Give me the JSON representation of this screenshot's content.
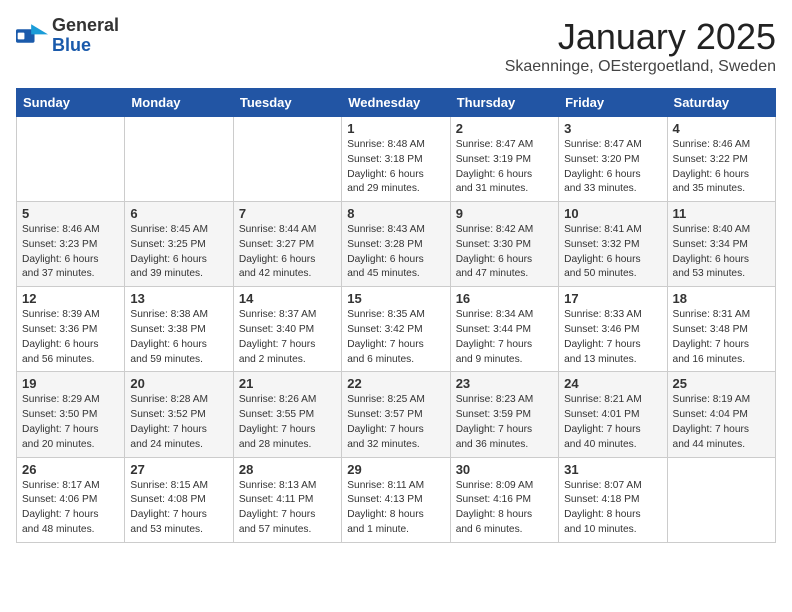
{
  "header": {
    "logo_general": "General",
    "logo_blue": "Blue",
    "title": "January 2025",
    "location": "Skaenninge, OEstergoetland, Sweden"
  },
  "weekdays": [
    "Sunday",
    "Monday",
    "Tuesday",
    "Wednesday",
    "Thursday",
    "Friday",
    "Saturday"
  ],
  "weeks": [
    [
      {
        "day": "",
        "info": ""
      },
      {
        "day": "",
        "info": ""
      },
      {
        "day": "",
        "info": ""
      },
      {
        "day": "1",
        "info": "Sunrise: 8:48 AM\nSunset: 3:18 PM\nDaylight: 6 hours\nand 29 minutes."
      },
      {
        "day": "2",
        "info": "Sunrise: 8:47 AM\nSunset: 3:19 PM\nDaylight: 6 hours\nand 31 minutes."
      },
      {
        "day": "3",
        "info": "Sunrise: 8:47 AM\nSunset: 3:20 PM\nDaylight: 6 hours\nand 33 minutes."
      },
      {
        "day": "4",
        "info": "Sunrise: 8:46 AM\nSunset: 3:22 PM\nDaylight: 6 hours\nand 35 minutes."
      }
    ],
    [
      {
        "day": "5",
        "info": "Sunrise: 8:46 AM\nSunset: 3:23 PM\nDaylight: 6 hours\nand 37 minutes."
      },
      {
        "day": "6",
        "info": "Sunrise: 8:45 AM\nSunset: 3:25 PM\nDaylight: 6 hours\nand 39 minutes."
      },
      {
        "day": "7",
        "info": "Sunrise: 8:44 AM\nSunset: 3:27 PM\nDaylight: 6 hours\nand 42 minutes."
      },
      {
        "day": "8",
        "info": "Sunrise: 8:43 AM\nSunset: 3:28 PM\nDaylight: 6 hours\nand 45 minutes."
      },
      {
        "day": "9",
        "info": "Sunrise: 8:42 AM\nSunset: 3:30 PM\nDaylight: 6 hours\nand 47 minutes."
      },
      {
        "day": "10",
        "info": "Sunrise: 8:41 AM\nSunset: 3:32 PM\nDaylight: 6 hours\nand 50 minutes."
      },
      {
        "day": "11",
        "info": "Sunrise: 8:40 AM\nSunset: 3:34 PM\nDaylight: 6 hours\nand 53 minutes."
      }
    ],
    [
      {
        "day": "12",
        "info": "Sunrise: 8:39 AM\nSunset: 3:36 PM\nDaylight: 6 hours\nand 56 minutes."
      },
      {
        "day": "13",
        "info": "Sunrise: 8:38 AM\nSunset: 3:38 PM\nDaylight: 6 hours\nand 59 minutes."
      },
      {
        "day": "14",
        "info": "Sunrise: 8:37 AM\nSunset: 3:40 PM\nDaylight: 7 hours\nand 2 minutes."
      },
      {
        "day": "15",
        "info": "Sunrise: 8:35 AM\nSunset: 3:42 PM\nDaylight: 7 hours\nand 6 minutes."
      },
      {
        "day": "16",
        "info": "Sunrise: 8:34 AM\nSunset: 3:44 PM\nDaylight: 7 hours\nand 9 minutes."
      },
      {
        "day": "17",
        "info": "Sunrise: 8:33 AM\nSunset: 3:46 PM\nDaylight: 7 hours\nand 13 minutes."
      },
      {
        "day": "18",
        "info": "Sunrise: 8:31 AM\nSunset: 3:48 PM\nDaylight: 7 hours\nand 16 minutes."
      }
    ],
    [
      {
        "day": "19",
        "info": "Sunrise: 8:29 AM\nSunset: 3:50 PM\nDaylight: 7 hours\nand 20 minutes."
      },
      {
        "day": "20",
        "info": "Sunrise: 8:28 AM\nSunset: 3:52 PM\nDaylight: 7 hours\nand 24 minutes."
      },
      {
        "day": "21",
        "info": "Sunrise: 8:26 AM\nSunset: 3:55 PM\nDaylight: 7 hours\nand 28 minutes."
      },
      {
        "day": "22",
        "info": "Sunrise: 8:25 AM\nSunset: 3:57 PM\nDaylight: 7 hours\nand 32 minutes."
      },
      {
        "day": "23",
        "info": "Sunrise: 8:23 AM\nSunset: 3:59 PM\nDaylight: 7 hours\nand 36 minutes."
      },
      {
        "day": "24",
        "info": "Sunrise: 8:21 AM\nSunset: 4:01 PM\nDaylight: 7 hours\nand 40 minutes."
      },
      {
        "day": "25",
        "info": "Sunrise: 8:19 AM\nSunset: 4:04 PM\nDaylight: 7 hours\nand 44 minutes."
      }
    ],
    [
      {
        "day": "26",
        "info": "Sunrise: 8:17 AM\nSunset: 4:06 PM\nDaylight: 7 hours\nand 48 minutes."
      },
      {
        "day": "27",
        "info": "Sunrise: 8:15 AM\nSunset: 4:08 PM\nDaylight: 7 hours\nand 53 minutes."
      },
      {
        "day": "28",
        "info": "Sunrise: 8:13 AM\nSunset: 4:11 PM\nDaylight: 7 hours\nand 57 minutes."
      },
      {
        "day": "29",
        "info": "Sunrise: 8:11 AM\nSunset: 4:13 PM\nDaylight: 8 hours\nand 1 minute."
      },
      {
        "day": "30",
        "info": "Sunrise: 8:09 AM\nSunset: 4:16 PM\nDaylight: 8 hours\nand 6 minutes."
      },
      {
        "day": "31",
        "info": "Sunrise: 8:07 AM\nSunset: 4:18 PM\nDaylight: 8 hours\nand 10 minutes."
      },
      {
        "day": "",
        "info": ""
      }
    ]
  ]
}
